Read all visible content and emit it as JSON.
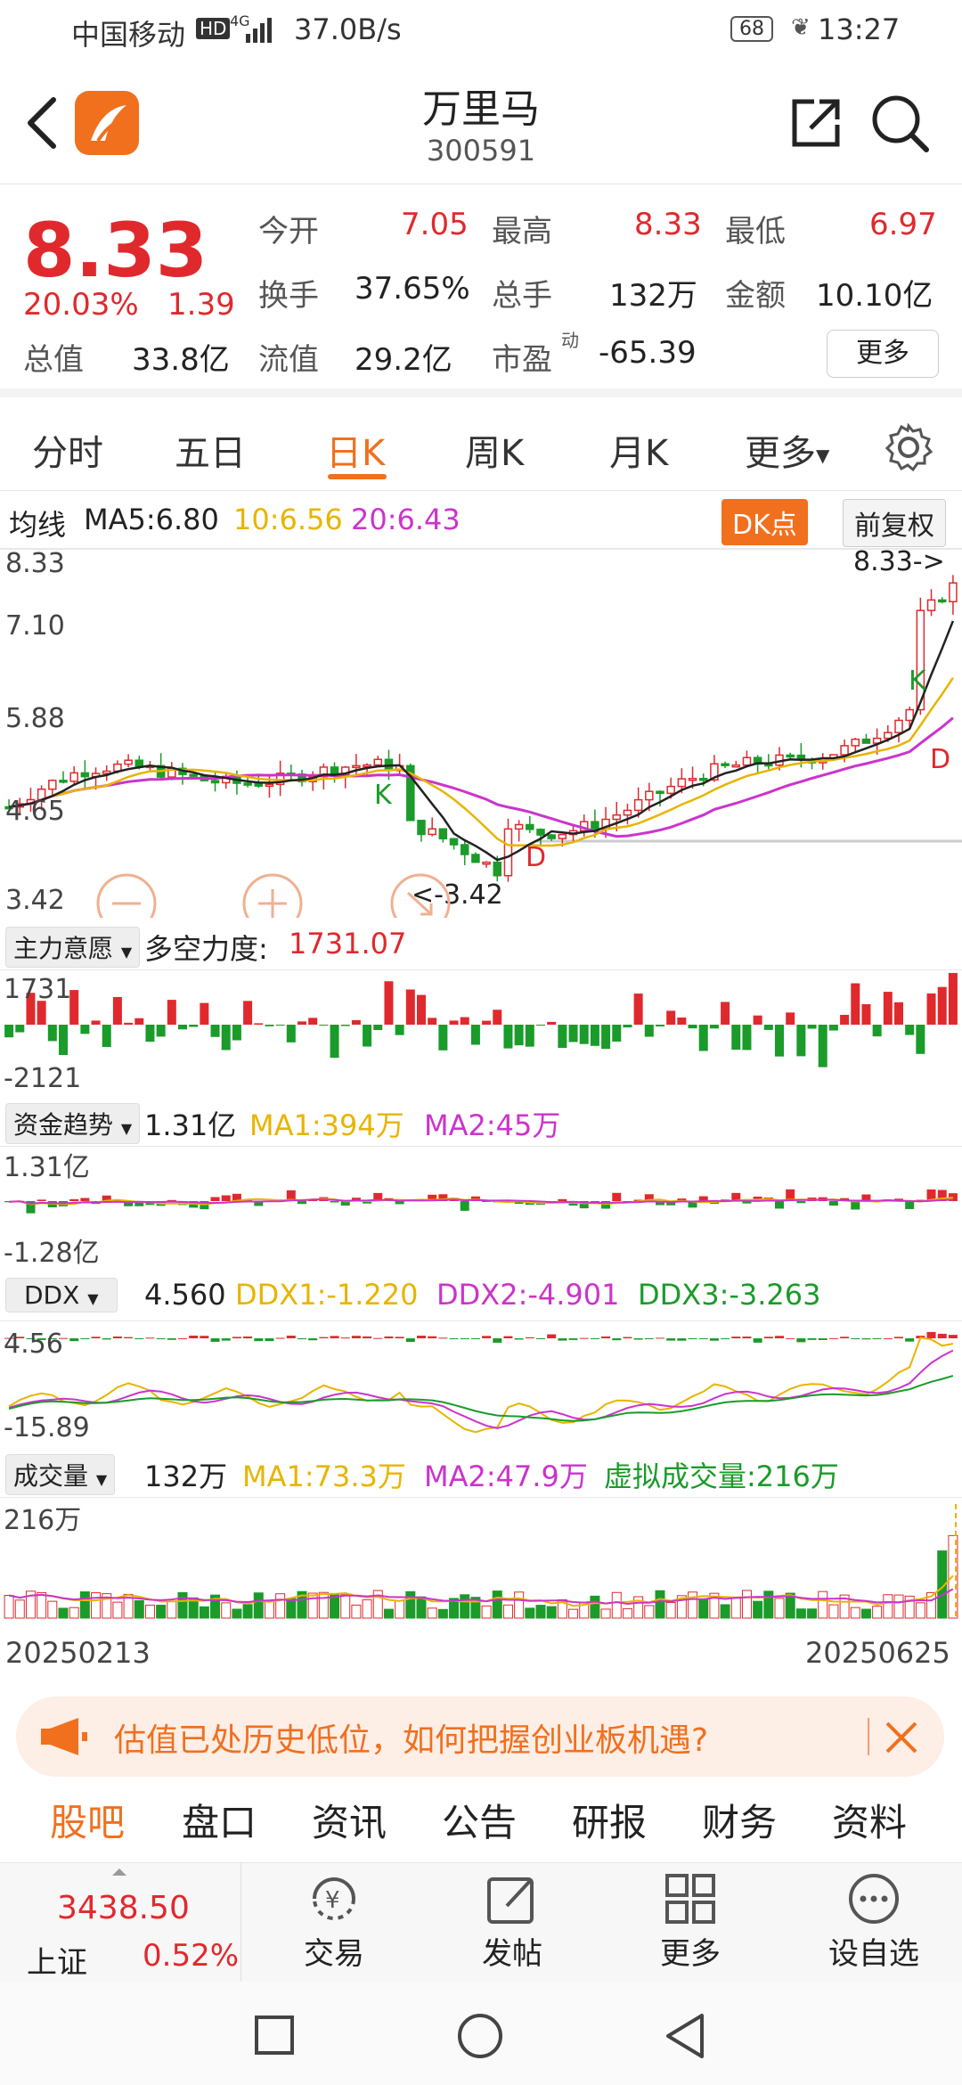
{
  "status_bar": {
    "carrier": "中国移动",
    "hd": "HD",
    "net": "4G",
    "speed": "37.0B/s",
    "battery": "68",
    "time": "13:27"
  },
  "header": {
    "title": "万里马",
    "code": "300591",
    "icons": [
      "back-icon",
      "app-logo",
      "share-icon",
      "search-icon"
    ]
  },
  "quote": {
    "price": "8.33",
    "change_pct": "20.03%",
    "change_amt": "1.39",
    "open_label": "今开",
    "open": "7.05",
    "high_label": "最高",
    "high": "8.33",
    "low_label": "最低",
    "low": "6.97",
    "turnover_label": "换手",
    "turnover": "37.65%",
    "volume_label": "总手",
    "volume": "132万",
    "amount_label": "金额",
    "amount": "10.10亿",
    "mktcap_label": "总值",
    "mktcap": "33.8亿",
    "float_label": "流值",
    "float": "29.2亿",
    "pe_label": "市盈",
    "pe_sup": "动",
    "pe": "-65.39",
    "more_btn": "更多"
  },
  "tabs": {
    "items": [
      "分时",
      "五日",
      "日K",
      "周K",
      "月K",
      "更多"
    ],
    "active": 2
  },
  "kline": {
    "ma_label": "均线",
    "ma5": "MA5:6.80",
    "ma10": "10:6.56",
    "ma20": "20:6.43",
    "dk_btn": "DK点",
    "adjust_btn": "前复权",
    "y_ticks": [
      "8.33",
      "7.10",
      "5.88",
      "4.65",
      "3.42"
    ],
    "high_mark": "8.33->",
    "low_mark": "<-3.42",
    "signals": [
      "K",
      "D",
      "K",
      "D"
    ]
  },
  "zlyy": {
    "selector": "主力意愿",
    "label": "多空力度:",
    "value": "1731.07",
    "y_top": "1731",
    "y_bottom": "-2121"
  },
  "zjqs": {
    "selector": "资金趋势",
    "value": "1.31亿",
    "ma1": "MA1:394万",
    "ma2": "MA2:45万",
    "y_top": "1.31亿",
    "y_bottom": "-1.28亿"
  },
  "ddx": {
    "selector": "DDX",
    "value": "4.560",
    "ddx1": "DDX1:-1.220",
    "ddx2": "DDX2:-4.901",
    "ddx3": "DDX3:-3.263",
    "y_top": "4.56",
    "y_bottom": "-15.89"
  },
  "vol": {
    "selector": "成交量",
    "value": "132万",
    "ma1": "MA1:73.3万",
    "ma2": "MA2:47.9万",
    "virtual": "虚拟成交量:216万",
    "y_top": "216万"
  },
  "date_range": {
    "start": "20250213",
    "end": "20250625"
  },
  "banner": {
    "text": "估值已处历史低位，如何把握创业板机遇?"
  },
  "bottom_tabs": [
    "股吧",
    "盘口",
    "资讯",
    "公告",
    "研报",
    "财务",
    "资料"
  ],
  "footer": {
    "index_value": "3438.50",
    "index_name": "上证",
    "index_change": "0.52%",
    "buttons": [
      "交易",
      "发帖",
      "更多",
      "设自选"
    ]
  },
  "colors": {
    "up": "#e0292d",
    "down": "#1a9b2a",
    "accent": "#f0701e",
    "ma5": "#222222",
    "ma10": "#e8b400",
    "ma20": "#cc33cc"
  }
}
